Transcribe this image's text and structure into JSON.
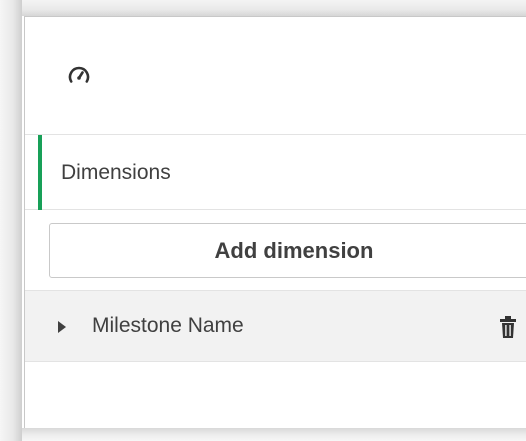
{
  "panel": {
    "icon": "gauge-icon",
    "section_title": "Dimensions",
    "accent_color": "#18a058",
    "add_button_label": "Add dimension",
    "dimensions": [
      {
        "label": "Milestone Name",
        "expand_icon": "caret-right-icon",
        "delete_icon": "trash-icon"
      }
    ]
  }
}
